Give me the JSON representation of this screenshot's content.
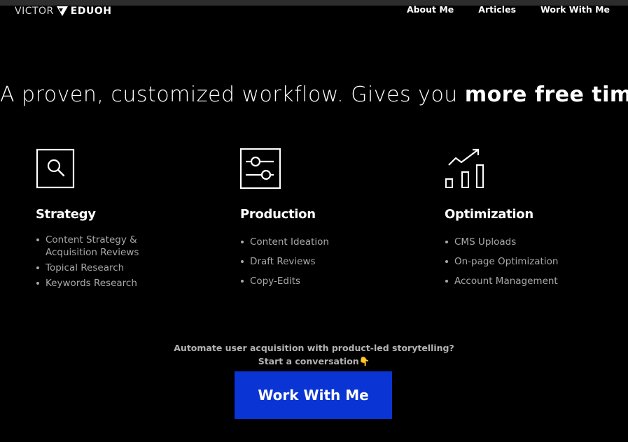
{
  "header": {
    "logo_first": "VICTOR",
    "logo_last": "EDUOH",
    "nav": [
      {
        "label": "About Me"
      },
      {
        "label": "Articles"
      },
      {
        "label": "Work With Me"
      }
    ]
  },
  "hero": {
    "headline_regular": "A proven, customized workflow. Gives you ",
    "headline_bold": "more free time"
  },
  "services": [
    {
      "icon": "search-icon",
      "title": "Strategy",
      "items": [
        "Content Strategy &",
        "Acquisition Reviews",
        "Topical Research",
        "Keywords Research"
      ]
    },
    {
      "icon": "sliders-icon",
      "title": "Production",
      "items": [
        "Content Ideation",
        "Draft Reviews",
        "Copy-Edits"
      ]
    },
    {
      "icon": "growth-chart-icon",
      "title": "Optimization",
      "items": [
        "CMS Uploads",
        "On-page Optimization",
        "Account Management"
      ]
    }
  ],
  "cta": {
    "line1": "Automate user acquisition with product-led storytelling?",
    "line2": "Start a conversation👇",
    "button_label": "Work With Me"
  },
  "colors": {
    "background": "#000000",
    "accent": "#0a34d4",
    "muted_text": "#a8a8a8"
  }
}
